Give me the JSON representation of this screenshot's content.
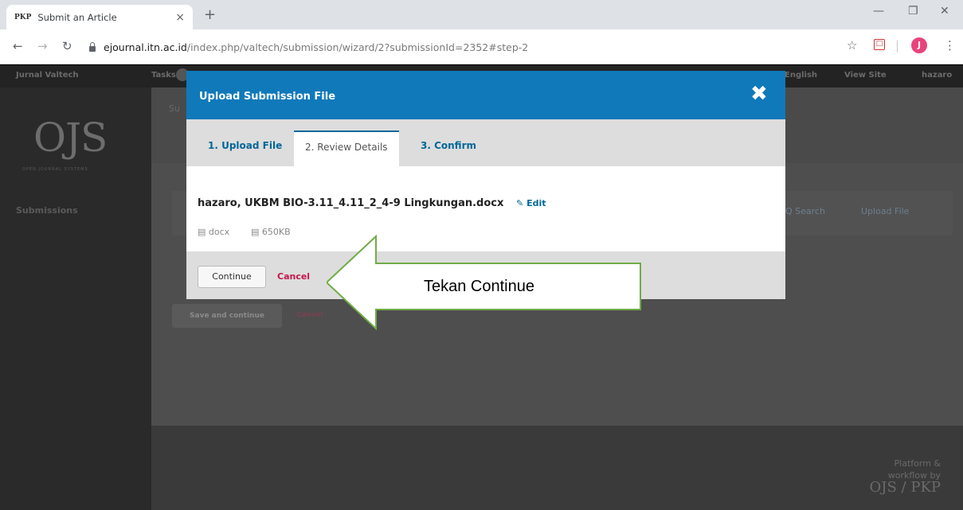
{
  "browser": {
    "tab_favicon": "PKP",
    "tab_title": "Submit an Article",
    "tab_close": "×",
    "new_tab": "+",
    "url_host": "ejournal.itn.ac.id",
    "url_path": "/index.php/valtech/submission/wizard/2?submissionId=2352#step-2",
    "avatar_letter": "J"
  },
  "page": {
    "journal_name": "Jurnal Valtech",
    "tasks": "Tasks",
    "lang": "English",
    "view_site": "View Site",
    "user": "hazaro",
    "logo": "OJS",
    "logo_sub": "OPEN JOURNAL SYSTEMS",
    "sidebar_submissions": "Submissions",
    "step_title": "Su",
    "search": "Q Search",
    "upload_file": "Upload File",
    "save_continue": "Save and continue",
    "cancel": "Cancel",
    "platform_line1": "Platform &",
    "platform_line2": "workflow by",
    "platform_logo": "OJS / PKP"
  },
  "modal": {
    "title": "Upload Submission File",
    "tabs": [
      {
        "label": "1. Upload File"
      },
      {
        "label": "2. Review Details"
      },
      {
        "label": "3. Confirm"
      }
    ],
    "file_name": "hazaro, UKBM BIO-3.11_4.11_2_4-9 Lingkungan.docx",
    "edit": "Edit",
    "file_type": "docx",
    "file_size": "650KB",
    "continue": "Continue",
    "cancel": "Cancel"
  },
  "annotation": {
    "text": "Tekan Continue",
    "fill": "#ffffff",
    "stroke": "#70ad47"
  },
  "colors": {
    "modal_header": "#0f79ba",
    "link": "#006798",
    "cancel": "#c4164d"
  }
}
